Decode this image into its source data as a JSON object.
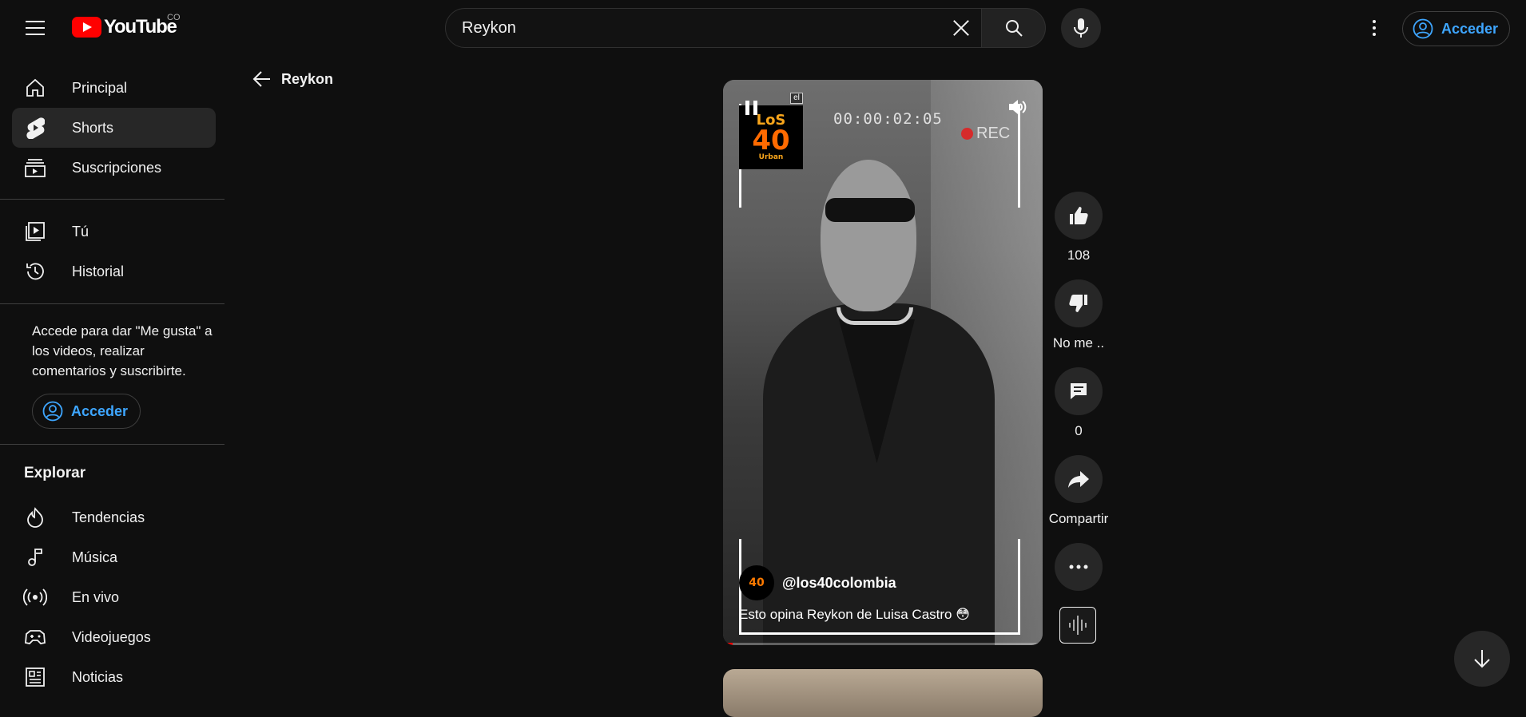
{
  "header": {
    "logo_text": "YouTube",
    "country_code": "CO",
    "search_value": "Reykon",
    "signin_label": "Acceder"
  },
  "sidebar": {
    "items": [
      {
        "label": "Principal",
        "icon": "home-icon"
      },
      {
        "label": "Shorts",
        "icon": "shorts-icon",
        "active": true
      },
      {
        "label": "Suscripciones",
        "icon": "subscriptions-icon"
      },
      {
        "label": "Tú",
        "icon": "you-icon"
      },
      {
        "label": "Historial",
        "icon": "history-icon"
      }
    ],
    "signin_prompt": "Accede para dar \"Me gusta\" a los videos, realizar comentarios y suscribirte.",
    "signin_label": "Acceder",
    "explore_title": "Explorar",
    "explore_items": [
      {
        "label": "Tendencias",
        "icon": "trending-icon"
      },
      {
        "label": "Música",
        "icon": "music-icon"
      },
      {
        "label": "En vivo",
        "icon": "live-icon"
      },
      {
        "label": "Videojuegos",
        "icon": "gaming-icon"
      },
      {
        "label": "Noticias",
        "icon": "news-icon"
      }
    ]
  },
  "main": {
    "back_label": "Reykon",
    "video": {
      "timestamp": "00:00:02:05",
      "rec_label": "REC",
      "cc_badge": "el",
      "logo_line1": "LoS",
      "logo_line2": "40",
      "logo_line3": "Urban",
      "channel_handle": "@los40colombia",
      "channel_avatar_text": "40",
      "caption": "Esto opina Reykon de Luisa Castro 😳",
      "progress": 0.03
    },
    "actions": {
      "like_count": "108",
      "dislike_label": "No me ..",
      "comments_count": "0",
      "share_label": "Compartir"
    }
  },
  "colors": {
    "background": "#0f0f0f",
    "accent_blue": "#3ea6ff",
    "brand_red": "#ff0000",
    "active_item": "#272727"
  }
}
